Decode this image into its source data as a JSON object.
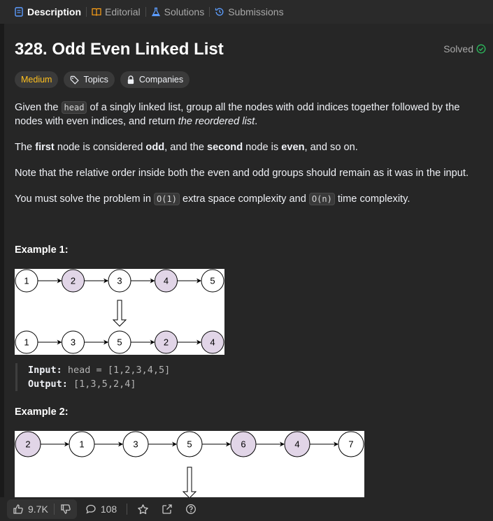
{
  "tabs": [
    {
      "label": "Description",
      "icon": "description-icon",
      "active": true
    },
    {
      "label": "Editorial",
      "icon": "book-icon",
      "active": false
    },
    {
      "label": "Solutions",
      "icon": "flask-icon",
      "active": false
    },
    {
      "label": "Submissions",
      "icon": "history-icon",
      "active": false
    }
  ],
  "problem": {
    "title": "328. Odd Even Linked List",
    "status": "Solved",
    "difficulty": "Medium",
    "topics_label": "Topics",
    "companies_label": "Companies"
  },
  "description": {
    "p1_a": "Given the ",
    "p1_code": "head",
    "p1_b": " of a singly linked list, group all the nodes with odd indices together followed by the nodes with even indices, and return ",
    "p1_em": "the reordered list",
    "p1_c": ".",
    "p2_a": "The ",
    "p2_b1": "first",
    "p2_b": " node is considered ",
    "p2_b2": "odd",
    "p2_c": ", and the ",
    "p2_b3": "second",
    "p2_d": " node is ",
    "p2_b4": "even",
    "p2_e": ", and so on.",
    "p3": "Note that the relative order inside both the even and odd groups should remain as it was in the input.",
    "p4_a": "You must solve the problem in ",
    "p4_code1": "O(1)",
    "p4_b": " extra space complexity and ",
    "p4_code2": "O(n)",
    "p4_c": " time complexity."
  },
  "example1": {
    "title": "Example 1:",
    "top_nodes": [
      "1",
      "2",
      "3",
      "4",
      "5"
    ],
    "bottom_nodes": [
      "1",
      "3",
      "5",
      "2",
      "4"
    ],
    "input_label": "Input:",
    "input_value": "head = [1,2,3,4,5]",
    "output_label": "Output:",
    "output_value": "[1,3,5,2,4]"
  },
  "example2": {
    "title": "Example 2:",
    "top_nodes": [
      "2",
      "1",
      "3",
      "5",
      "6",
      "4",
      "7"
    ]
  },
  "bottombar": {
    "likes": "9.7K",
    "comments": "108"
  },
  "colors": {
    "even_node_fill": "#e1d5e7",
    "odd_node_fill": "#ffffff",
    "medium": "#ffc01e",
    "solved_check": "#2cbb5d"
  }
}
